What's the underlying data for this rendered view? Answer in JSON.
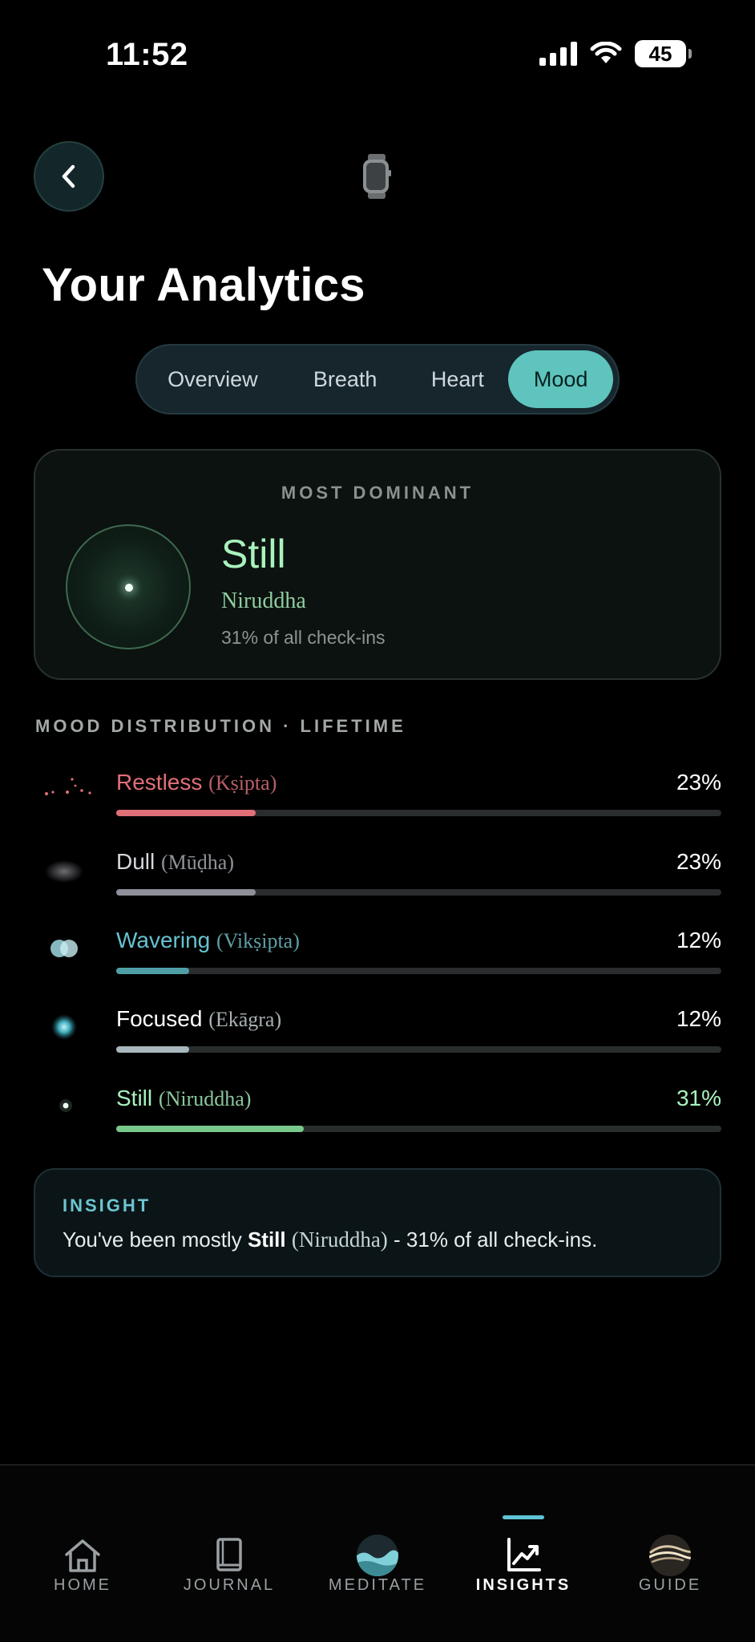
{
  "status_bar": {
    "time": "11:52",
    "battery": "45"
  },
  "header": {
    "title": "Your Analytics"
  },
  "tabs": [
    {
      "label": "Overview",
      "active": false
    },
    {
      "label": "Breath",
      "active": false
    },
    {
      "label": "Heart",
      "active": false
    },
    {
      "label": "Mood",
      "active": true
    }
  ],
  "dominant": {
    "label": "MOST DOMINANT",
    "mood": "Still",
    "sanskrit": "Niruddha",
    "share_text": "31% of all check-ins"
  },
  "distribution": {
    "title": "MOOD DISTRIBUTION · LIFETIME",
    "items": [
      {
        "name": "Restless",
        "sanskrit": "(Kṣipta)",
        "percent": "23%",
        "value": 0.23,
        "color": "#e06f78",
        "sk_color": "#b85f66",
        "pct_color": "#ffffff",
        "icon": "scatter-dots-icon"
      },
      {
        "name": "Dull",
        "sanskrit": "(Mūḍha)",
        "percent": "23%",
        "value": 0.23,
        "color": "#8d8f99",
        "sk_color": "#8f9298",
        "name_color": "#d6d8dc",
        "pct_color": "#ffffff",
        "icon": "blur-oval-icon"
      },
      {
        "name": "Wavering",
        "sanskrit": "(Vikṣipta)",
        "percent": "12%",
        "value": 0.12,
        "color": "#4e9ea6",
        "sk_color": "#5f9fa6",
        "name_color": "#66c2cf",
        "pct_color": "#ffffff",
        "icon": "double-circle-icon"
      },
      {
        "name": "Focused",
        "sanskrit": "(Ekāgra)",
        "percent": "12%",
        "value": 0.12,
        "color": "#a7b7bd",
        "sk_color": "#a8b0b2",
        "name_color": "#ffffff",
        "pct_color": "#ffffff",
        "icon": "glow-orb-icon"
      },
      {
        "name": "Still",
        "sanskrit": "(Niruddha)",
        "percent": "31%",
        "value": 0.31,
        "color": "#78c88c",
        "sk_color": "#8cc79c",
        "name_color": "#a9f2bd",
        "pct_color": "#a9f2bd",
        "icon": "point-icon"
      }
    ]
  },
  "insight": {
    "label": "INSIGHT",
    "prefix": "You've been mostly ",
    "mood": "Still",
    "sanskrit": "(Niruddha)",
    "suffix": " - 31% of all check-ins."
  },
  "nav": [
    {
      "label": "HOME",
      "icon": "home-icon",
      "active": false
    },
    {
      "label": "JOURNAL",
      "icon": "book-icon",
      "active": false
    },
    {
      "label": "MEDITATE",
      "icon": "wave-orb-icon",
      "active": false
    },
    {
      "label": "INSIGHTS",
      "icon": "chart-up-icon",
      "active": true
    },
    {
      "label": "GUIDE",
      "icon": "guide-orb-icon",
      "active": false
    }
  ]
}
